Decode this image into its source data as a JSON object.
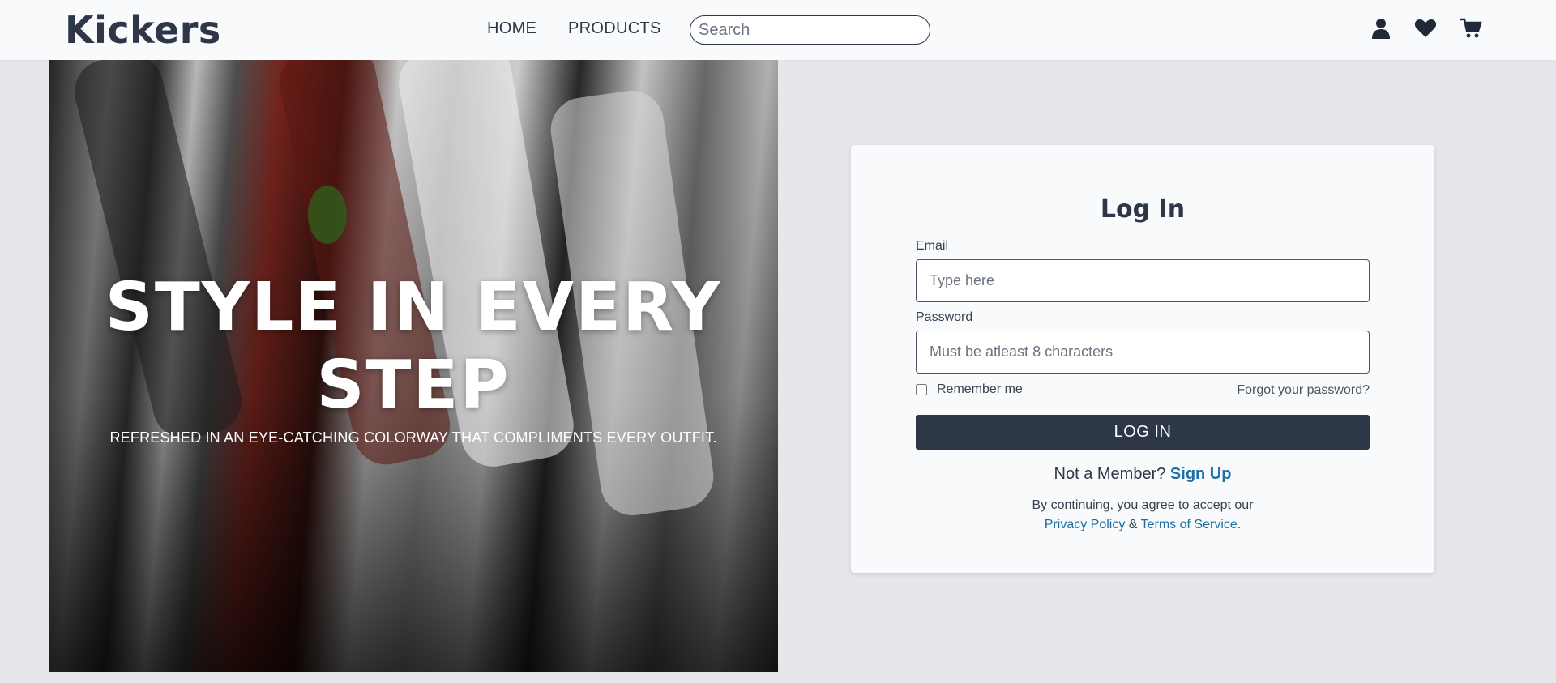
{
  "header": {
    "logo": "Kickers",
    "nav": [
      {
        "label": "HOME"
      },
      {
        "label": "PRODUCTS"
      }
    ],
    "search_placeholder": "Search",
    "icons": [
      "user-icon",
      "heart-icon",
      "cart-icon"
    ]
  },
  "hero": {
    "title_line1": "STYLE IN EVERY",
    "title_line2": "STEP",
    "subtitle": "REFRESHED IN AN EYE-CATCHING COLORWAY THAT COMPLIMENTS EVERY OUTFIT."
  },
  "login": {
    "title": "Log In",
    "email_label": "Email",
    "email_placeholder": "Type here",
    "password_label": "Password",
    "password_placeholder": "Must be atleast 8 characters",
    "remember_label": "Remember me",
    "forgot_label": "Forgot your password?",
    "button_label": "LOG IN",
    "member_text": "Not a Member?",
    "signup_label": "Sign Up",
    "legal_text": "By continuing, you agree to accept our",
    "privacy_label": "Privacy Policy",
    "and_text": "&",
    "terms_label": "Terms of Service",
    "period": "."
  },
  "colors": {
    "primary": "#2d3748",
    "link": "#1d6fa5",
    "background": "#e5e7eb",
    "surface": "#f8fafc"
  }
}
